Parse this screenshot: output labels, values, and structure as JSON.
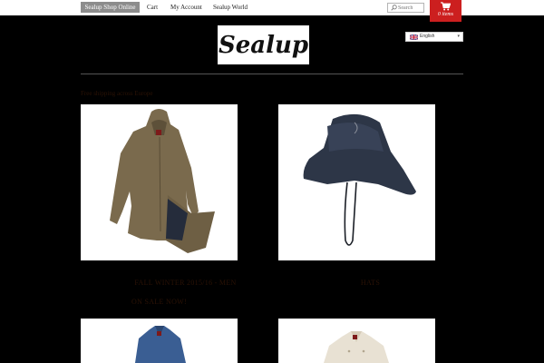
{
  "nav": {
    "shop_online": "Sealup Shop Online",
    "cart": "Cart",
    "my_account": "My Account",
    "world": "Sealup World"
  },
  "search": {
    "placeholder": "Search"
  },
  "cart_widget": {
    "count_label": "0 items"
  },
  "logo": {
    "text": "Sealup"
  },
  "language": {
    "selected": "English"
  },
  "promo_text": "Free shipping across Europe",
  "products": [
    {
      "title": "FALL WINTER 2015/16 - MEN",
      "subtitle": "ON SALE NOW!"
    },
    {
      "title": "HATS"
    }
  ],
  "colors": {
    "background": "#000000",
    "cart_red": "#cc1f1f",
    "active_nav": "#8c8c8c",
    "caption_text": "#2b1205"
  }
}
